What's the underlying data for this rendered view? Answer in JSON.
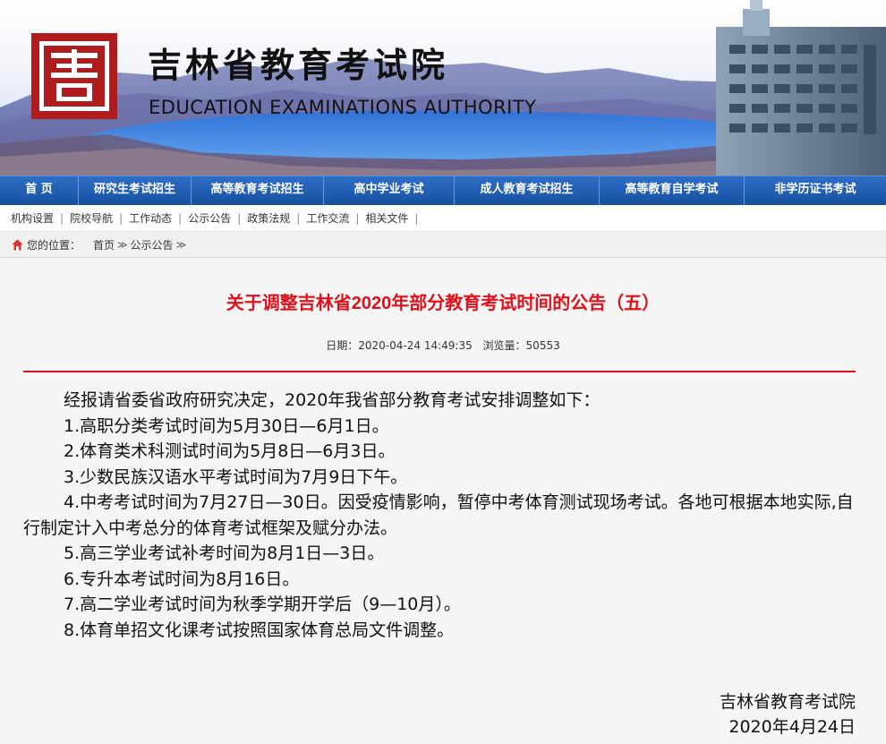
{
  "header": {
    "title_cn": "吉林省教育考试院",
    "title_en": "EDUCATION EXAMINATIONS AUTHORITY",
    "logo_icon": "ji-seal-logo",
    "logo_color": "#b01b1e"
  },
  "main_nav": [
    {
      "label": "首 页"
    },
    {
      "label": "研究生考试招生"
    },
    {
      "label": "高等教育考试招生"
    },
    {
      "label": "高中学业考试"
    },
    {
      "label": "成人教育考试招生"
    },
    {
      "label": "高等教育自学考试"
    },
    {
      "label": "非学历证书考试"
    }
  ],
  "sub_nav": [
    {
      "label": "机构设置"
    },
    {
      "label": "院校导航"
    },
    {
      "label": "工作动态"
    },
    {
      "label": "公示公告"
    },
    {
      "label": "政策法规"
    },
    {
      "label": "工作交流"
    },
    {
      "label": "相关文件"
    }
  ],
  "breadcrumb": {
    "label": "您的位置：",
    "home": "首页",
    "current": "公示公告",
    "separator": "≫"
  },
  "article": {
    "title": "关于调整吉林省2020年部分教育考试时间的公告（五）",
    "date": "日期：2020-04-24 14:49:35",
    "views": "浏览量：50553",
    "paragraphs": [
      "经报请省委省政府研究决定，2020年我省部分教育考试安排调整如下：",
      "1.高职分类考试时间为5月30日—6月1日。",
      "2.体育类术科测试时间为5月8日—6月3日。",
      "3.少数民族汉语水平考试时间为7月9日下午。",
      "4.中考考试时间为7月27日—30日。因受疫情影响，暂停中考体育测试现场考试。各地可根据本地实际,自行制定计入中考总分的体育考试框架及赋分办法。",
      "5.高三学业考试补考时间为8月1日—3日。",
      "6.专升本考试时间为8月16日。",
      "7.高二学业考试时间为秋季学期开学后（9—10月）。",
      "8.体育单招文化课考试按照国家体育总局文件调整。"
    ],
    "signature_org": "吉林省教育考试院",
    "signature_date": "2020年4月24日"
  },
  "colors": {
    "accent_red": "#e2101a",
    "nav_blue": "#1f5cb0"
  }
}
